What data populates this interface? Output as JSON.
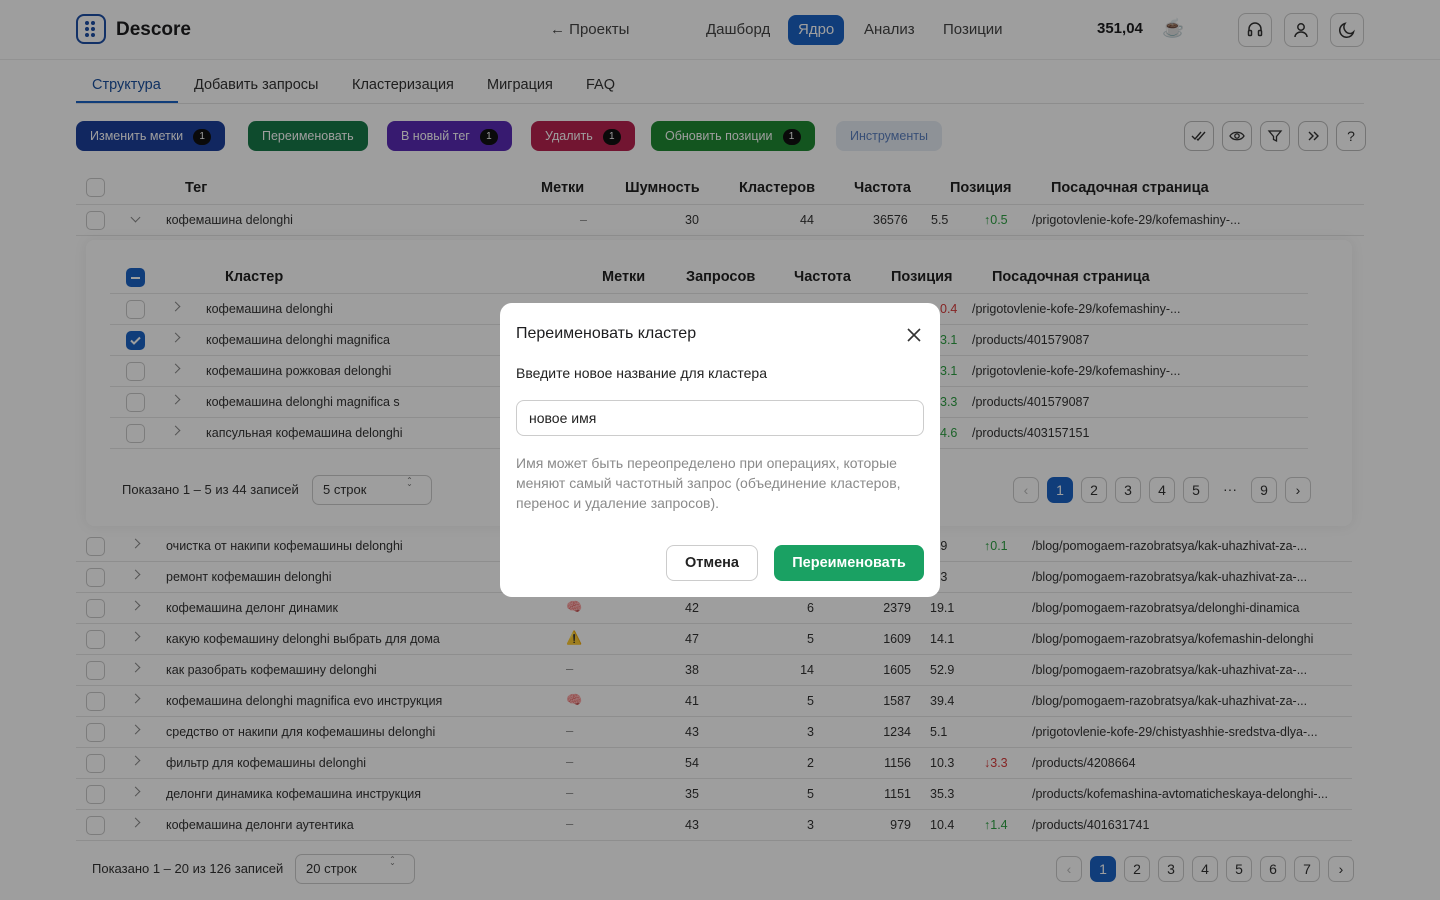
{
  "header": {
    "brand": "Descore",
    "back": "← Проекты",
    "nav": [
      "Дашборд",
      "Ядро",
      "Анализ",
      "Позиции"
    ],
    "active_nav": "Ядро",
    "balance": "351,04",
    "cup": "☕"
  },
  "tabs": [
    "Структура",
    "Добавить запросы",
    "Кластеризация",
    "Миграция",
    "FAQ"
  ],
  "actions": [
    {
      "label": "Изменить метки",
      "badge": "1",
      "color": "#1c3f9c"
    },
    {
      "label": "Переименовать",
      "badge": "",
      "color": "#187a4a"
    },
    {
      "label": "В новый тег",
      "badge": "1",
      "color": "#5a2bb5"
    },
    {
      "label": "Удалить",
      "badge": "1",
      "color": "#b8224f"
    },
    {
      "label": "Обновить позиции",
      "badge": "1",
      "color": "#1f8a32"
    },
    {
      "label": "Инструменты",
      "badge": "",
      "color": "#e6ecf4"
    }
  ],
  "outer_headers": [
    "Тег",
    "Метки",
    "Шумность",
    "Кластеров",
    "Частота",
    "Позиция",
    "Посадочная страница"
  ],
  "open_row": {
    "tag": "кофемашина delonghi",
    "marks": "–",
    "noise": "30",
    "clusters": "44",
    "freq": "36576",
    "pos": "5.5",
    "delta": "↑0.5",
    "page": "/prigotovlenie-kofe-29/kofemashiny-..."
  },
  "inner_headers": [
    "Кластер",
    "Метки",
    "Запросов",
    "Частота",
    "Позиция",
    "Посадочная страница"
  ],
  "inner_rows": [
    {
      "name": "кофемашина delonghi",
      "pos": "0.4",
      "page": "/prigotovlenie-kofe-29/kofemashiny-...",
      "checked": false
    },
    {
      "name": "кофемашина delonghi magnifica",
      "pos": "3.1",
      "page": "/products/401579087",
      "checked": true
    },
    {
      "name": "кофемашина рожковая delonghi",
      "pos": "3.1",
      "page": "/prigotovlenie-kofe-29/kofemashiny-...",
      "checked": false
    },
    {
      "name": "кофемашина delonghi magnifica s",
      "pos": "3.3",
      "page": "/products/401579087",
      "checked": false
    },
    {
      "name": "капсульная кофемашина delonghi",
      "pos": "4.6",
      "page": "/products/403157151",
      "checked": false
    }
  ],
  "inner_footer": {
    "shown": "Показано 1 – 5 из 44 записей",
    "rows_select": "5 строк",
    "pages": [
      "1",
      "2",
      "3",
      "4",
      "5",
      "···",
      "9"
    ]
  },
  "outer_rows": [
    {
      "tag": "очистка от накипи кофемашины delonghi",
      "marks": "",
      "noise": "",
      "clusters": "",
      "freq": "",
      "pos": "0.9",
      "delta": "↑0.1",
      "dir": "up",
      "page": "/blog/pomogaem-razobratsya/kak-uhazhivat-za-..."
    },
    {
      "tag": "ремонт кофемашин delonghi",
      "marks": "",
      "noise": "",
      "clusters": "",
      "freq": "",
      "pos": "4.3",
      "delta": "",
      "dir": "",
      "page": "/blog/pomogaem-razobratsya/kak-uhazhivat-za-..."
    },
    {
      "tag": "кофемашина делонг динамик",
      "marks": "🧠",
      "noise": "42",
      "clusters": "6",
      "freq": "2379",
      "pos": "19.1",
      "delta": "",
      "dir": "",
      "page": "/blog/pomogaem-razobratsya/delonghi-dinamica"
    },
    {
      "tag": "какую кофемашину delonghi выбрать для дома",
      "marks": "⚠️",
      "noise": "47",
      "clusters": "5",
      "freq": "1609",
      "pos": "14.1",
      "delta": "",
      "dir": "",
      "page": "/blog/pomogaem-razobratsya/kofemashin-delonghi"
    },
    {
      "tag": "как разобрать кофемашину delonghi",
      "marks": "–",
      "noise": "38",
      "clusters": "14",
      "freq": "1605",
      "pos": "52.9",
      "delta": "",
      "dir": "",
      "page": "/blog/pomogaem-razobratsya/kak-uhazhivat-za-..."
    },
    {
      "tag": "кофемашина delonghi magnifica evo инструкция",
      "marks": "🧠",
      "noise": "41",
      "clusters": "5",
      "freq": "1587",
      "pos": "39.4",
      "delta": "",
      "dir": "",
      "page": "/blog/pomogaem-razobratsya/kak-uhazhivat-za-..."
    },
    {
      "tag": "средство от накипи для кофемашины delonghi",
      "marks": "–",
      "noise": "43",
      "clusters": "3",
      "freq": "1234",
      "pos": "5.1",
      "delta": "",
      "dir": "",
      "page": "/prigotovlenie-kofe-29/chistyashhie-sredstva-dlya-..."
    },
    {
      "tag": "фильтр для кофемашины delonghi",
      "marks": "–",
      "noise": "54",
      "clusters": "2",
      "freq": "1156",
      "pos": "10.3",
      "delta": "↓3.3",
      "dir": "down",
      "page": "/products/4208664"
    },
    {
      "tag": "делонги динамика кофемашина инструкция",
      "marks": "–",
      "noise": "35",
      "clusters": "5",
      "freq": "1151",
      "pos": "35.3",
      "delta": "",
      "dir": "",
      "page": "/products/kofemashina-avtomaticheskaya-delonghi-..."
    },
    {
      "tag": "кофемашина делонги аутентика",
      "marks": "–",
      "noise": "43",
      "clusters": "3",
      "freq": "979",
      "pos": "10.4",
      "delta": "↑1.4",
      "dir": "up",
      "page": "/products/401631741"
    }
  ],
  "outer_footer": {
    "shown": "Показано 1 – 20 из 126 записей",
    "rows_select": "20 строк",
    "pages": [
      "1",
      "2",
      "3",
      "4",
      "5",
      "6",
      "7"
    ]
  },
  "modal": {
    "title": "Переименовать кластер",
    "label": "Введите новое название для кластера",
    "value": "новое имя",
    "hint": "Имя может быть переопределено при операциях, которые меняют самый частотный запрос (объединение кластеров, перенос и удаление запросов).",
    "cancel": "Отмена",
    "confirm": "Переименовать"
  }
}
